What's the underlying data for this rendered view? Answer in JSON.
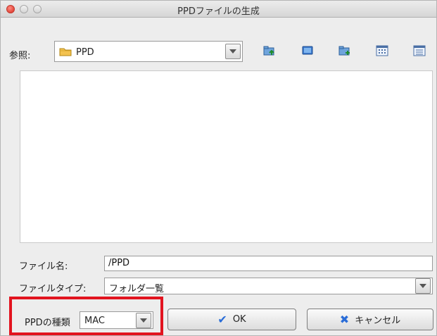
{
  "window": {
    "title": "PPDファイルの生成"
  },
  "lookin": {
    "label": "参照:",
    "value": "PPD"
  },
  "toolbar": {
    "icons": [
      "folder-up-icon",
      "desktop-icon",
      "new-folder-icon",
      "list-view-icon",
      "details-view-icon"
    ]
  },
  "form": {
    "filename_label": "ファイル名:",
    "filename_value": "/PPD",
    "filetype_label": "ファイルタイプ:",
    "filetype_value": "フォルダ一覧"
  },
  "ppd": {
    "label": "PPDの種類",
    "value": "MAC"
  },
  "buttons": {
    "ok_label": "OK",
    "cancel_label": "キャンセル"
  },
  "colors": {
    "highlight": "#e2141f",
    "accent": "#2a6dd8"
  }
}
